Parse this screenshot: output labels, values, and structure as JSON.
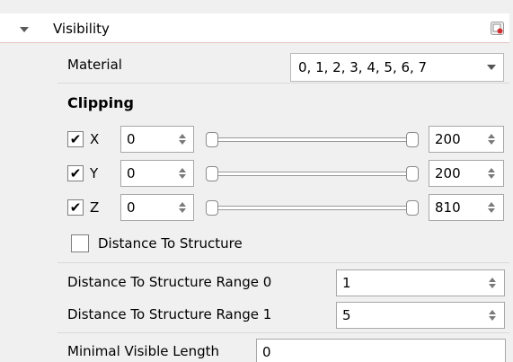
{
  "section": {
    "title": "Visibility",
    "expanded": true
  },
  "material": {
    "label": "Material",
    "value": "0, 1, 2, 3, 4, 5, 6, 7"
  },
  "clipping": {
    "title": "Clipping",
    "axes": [
      {
        "axis": "X",
        "checked": true,
        "min": "0",
        "max": "200",
        "range_min_fraction": 0.0,
        "range_max_fraction": 1.0
      },
      {
        "axis": "Y",
        "checked": true,
        "min": "0",
        "max": "200",
        "range_min_fraction": 0.0,
        "range_max_fraction": 1.0
      },
      {
        "axis": "Z",
        "checked": true,
        "min": "0",
        "max": "810",
        "range_min_fraction": 0.0,
        "range_max_fraction": 1.0
      }
    ],
    "check_glyph": "✔"
  },
  "distance_to_structure": {
    "label": "Distance To Structure",
    "checked": false
  },
  "range0": {
    "label": "Distance To Structure Range 0",
    "value": "1"
  },
  "range1": {
    "label": "Distance To Structure Range 1",
    "value": "5"
  },
  "minimal_visible_length": {
    "label": "Minimal Visible Length",
    "value": "0"
  },
  "colors": {
    "header_border": "#e8c0c0",
    "panel_bg": "#f0f0f0",
    "field_bg": "#ffffff"
  }
}
